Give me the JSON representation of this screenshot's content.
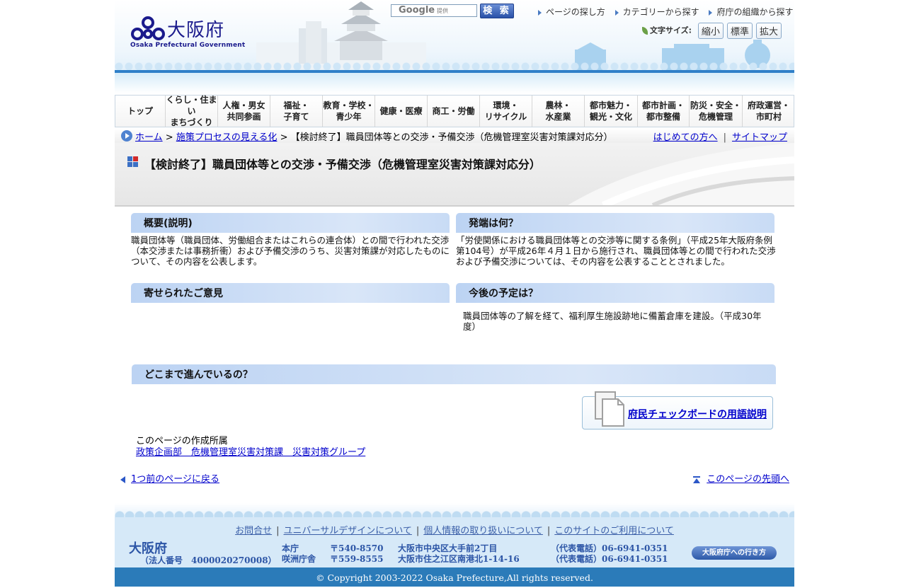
{
  "header": {
    "logo_text": "大阪府",
    "logo_sub": "Osaka Prefectural Government",
    "search": {
      "brand": "Google",
      "provided": "提供",
      "button": "検 索"
    },
    "toplinks": [
      "ページの探し方",
      "カテゴリーから探す",
      "府庁の組織から探す"
    ],
    "fontsize": {
      "label": "文字サイズ:",
      "small": "縮小",
      "normal": "標準",
      "large": "拡大"
    }
  },
  "nav": [
    {
      "line1": "トップ",
      "line2": ""
    },
    {
      "line1": "くらし・住まい",
      "line2": "まちづくり"
    },
    {
      "line1": "人権・男女",
      "line2": "共同参画"
    },
    {
      "line1": "福祉・",
      "line2": "子育て"
    },
    {
      "line1": "教育・学校・",
      "line2": "青少年"
    },
    {
      "line1": "健康・医療",
      "line2": ""
    },
    {
      "line1": "商工・労働",
      "line2": ""
    },
    {
      "line1": "環境・",
      "line2": "リサイクル"
    },
    {
      "line1": "農林・",
      "line2": "水産業"
    },
    {
      "line1": "都市魅力・",
      "line2": "観光・文化"
    },
    {
      "line1": "都市計画・",
      "line2": "都市整備"
    },
    {
      "line1": "防災・安全・",
      "line2": "危機管理"
    },
    {
      "line1": "府政運営・",
      "line2": "市町村"
    }
  ],
  "breadcrumb": {
    "home": "ホーム",
    "sep": ">",
    "level1": "施策プロセスの見える化",
    "current": "【検討終了】職員団体等との交渉・予備交渉（危機管理室災害対策課対応分）",
    "first_time": "はじめての方へ",
    "sitemap": "サイトマップ"
  },
  "page_title": "【検討終了】職員団体等との交渉・予備交渉（危機管理室災害対策課対応分）",
  "sections": {
    "overview": {
      "title": "概要(説明)",
      "body": "職員団体等（職員団体、労働組合またはこれらの連合体）との間で行われた交渉（本交渉または事務折衝）および予備交渉のうち、災害対策課が対応したものについて、その内容を公表します。"
    },
    "origin": {
      "title": "発端は何？",
      "body": "「労使関係における職員団体等との交渉等に関する条例」（平成25年大阪府条例第104号）が平成26年４月１日から施行され、職員団体等との間で行われた交渉および予備交渉については、その内容を公表することとされました。"
    },
    "opinions": {
      "title": "寄せられたご意見",
      "body": ""
    },
    "plan": {
      "title": "今後の予定は？",
      "body": "職員団体等の了解を経て、福利厚生施設跡地に備蓄倉庫を建設。（平成30年度）"
    },
    "progress": {
      "title": "どこまで進んでいるの？"
    }
  },
  "glossary_link": "府民チェックボードの用語説明",
  "owner": {
    "label": "このページの作成所属",
    "dept": "政策企画部　危機管理室災害対策課　災害対策グループ"
  },
  "back_link": "1つ前のページに戻る",
  "top_link": "このページの先頭へ",
  "footer": {
    "links": [
      "お問合せ",
      "ユニバーサルデザインについて",
      "個人情報の取り扱いについて",
      "このサイトのご利用について"
    ],
    "name": "大阪府",
    "corp_number": "（法人番号　4000020270008）",
    "offices": [
      {
        "name": "本庁",
        "zip": "〒540-8570",
        "address": "大阪市中央区大手前2丁目",
        "tel": "（代表電話）06-6941-0351"
      },
      {
        "name": "咲洲庁舎",
        "zip": "〒559-8555",
        "address": "大阪市住之江区南港北1-14-16",
        "tel": "（代表電話）06-6941-0351"
      }
    ],
    "access_button": "大阪府庁への行き方",
    "copyright": "© Copyright 2003-2022 Osaka Prefecture,All rights reserved."
  },
  "colors": {
    "accent": "#2f7fc8",
    "header_panel": "#bcd3f3",
    "footer_bg": "#d6e9f8",
    "copyright_bg": "#2b7bb9",
    "link": "#0000cc"
  }
}
